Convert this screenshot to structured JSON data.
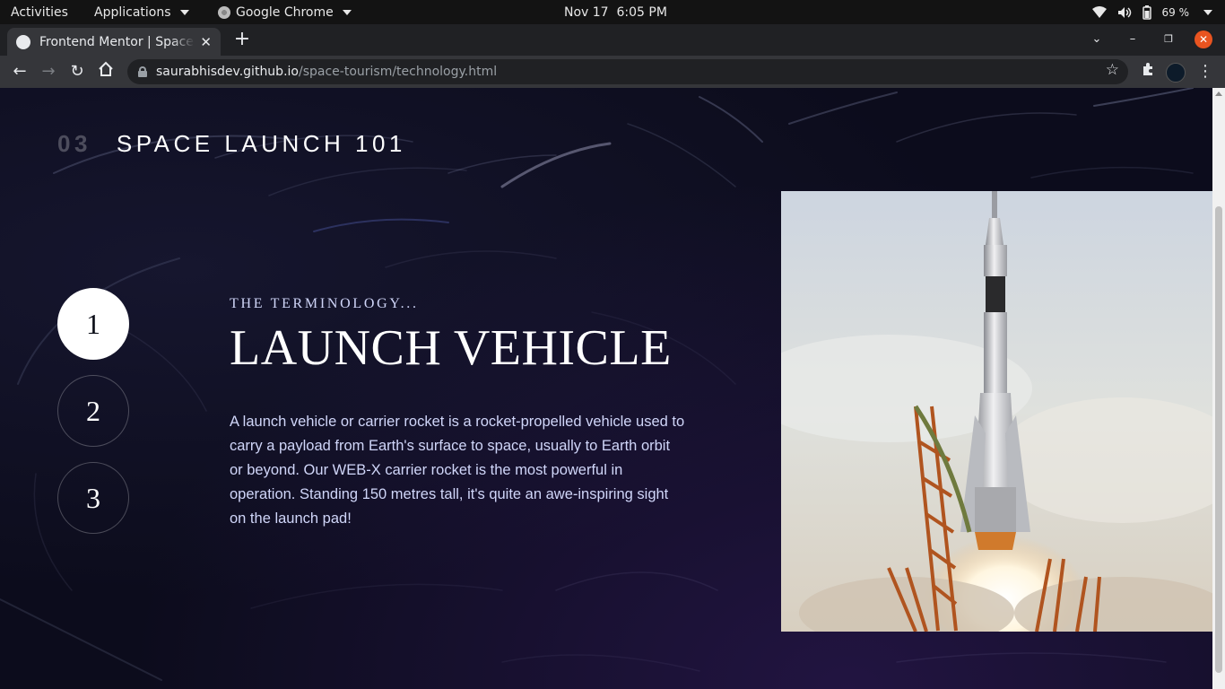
{
  "topbar": {
    "activities": "Activities",
    "applications": "Applications",
    "app_name": "Google Chrome",
    "clock": "Nov 17  6:05 PM",
    "battery": "69 %"
  },
  "browser": {
    "tab_title": "Frontend Mentor | Space tourism website",
    "url_host": "saurabhisdev.github.io",
    "url_path": "/space-tourism/technology.html"
  },
  "page": {
    "heading_number": "03",
    "heading_text": "SPACE LAUNCH 101",
    "steps": [
      "1",
      "2",
      "3"
    ],
    "active_step": 1,
    "terminology": "THE TERMINOLOGY...",
    "title": "LAUNCH VEHICLE",
    "description": "A launch vehicle or carrier rocket is a rocket-propelled vehicle used to carry a payload from Earth's surface to space, usually to Earth orbit or beyond. Our WEB-X carrier rocket is the most powerful in operation. Standing 150 metres tall, it's quite an awe-inspiring sight on the launch pad!"
  },
  "colors": {
    "page_bg": "#0b0d17",
    "accent_light": "#d0d6f9",
    "close_button": "#e95420"
  }
}
